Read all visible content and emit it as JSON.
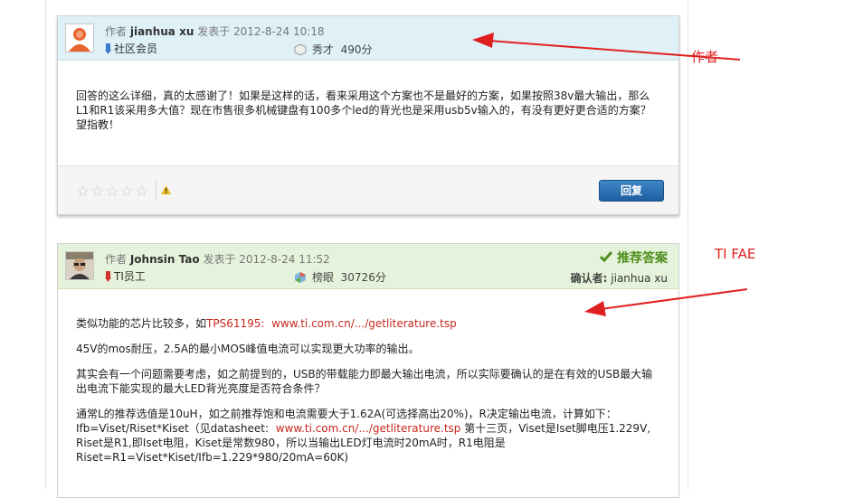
{
  "posts": [
    {
      "author_prefix": "作者",
      "author": "jianhua xu",
      "posted_label": "发表于",
      "date": "2012-8-24 10:18",
      "role": "社区会员",
      "rank_title": "秀才",
      "points": "490分",
      "paragraphs": [
        "回答的这么详细，真的太感谢了！如果是这样的话，看来采用这个方案也不是最好的方案，如果按照38v最大输出，那么L1和R1该采用多大值？现在市售很多机械键盘有100多个led的背光也是采用usb5v输入的，有没有更好更合适的方案？望指教！"
      ],
      "rating_stars": "☆☆☆☆☆",
      "reply_label": "回复"
    },
    {
      "author_prefix": "作者",
      "author": "Johnsin Tao",
      "posted_label": "发表于",
      "date": "2012-8-24 11:52",
      "role": "TI员工",
      "rank_title": "榜眼",
      "points": "30726分",
      "best_answer": "推荐答案",
      "confirm_label": "确认者:",
      "confirm_user": "jianhua xu",
      "p1_text": "类似功能的芯片比较多，如",
      "p1_part": "TPS61195",
      "p1_colon": ":",
      "p1_link": "www.ti.com.cn/.../getliterature.tsp",
      "p2": "45V的mos耐压，2.5A的最小MOS峰值电流可以实现更大功率的输出。",
      "p3": "其实会有一个问题需要考虑，如之前提到的，USB的带载能力即最大输出电流，所以实际要确认的是在有效的USB最大输出电流下能实现的最大LED背光亮度是否符合条件？",
      "p4_line1": "通常L的推荐选值是10uH，如之前推荐饱和电流需要大于1.62A(可选择高出20%)，R决定输出电流，计算如下：",
      "p4_formula_a": "Ifb=Viset/Riset*Kiset（见datasheet:",
      "p4_link": "www.ti.com.cn/.../getliterature.tsp",
      "p4_formula_b": "第十三页，Viset是Iset脚电压1.229V, Riset是R1,即Iset电阻，Kiset是常数980，所以当输出LED灯电流时20mA时，R1电阻是Riset=R1=Viset*Kiset/Ifb=1.229*980/20mA=60K)"
    }
  ],
  "annotations": {
    "author_note": "作者",
    "fae_note": "TI FAE"
  },
  "colors": {
    "annotation": "#e02020",
    "link": "#c8281e",
    "post1_header": "#dff0f7",
    "post2_header": "#e6f3dc",
    "best_answer": "#4f8f1e",
    "reply_button": "#2a6fb2"
  }
}
